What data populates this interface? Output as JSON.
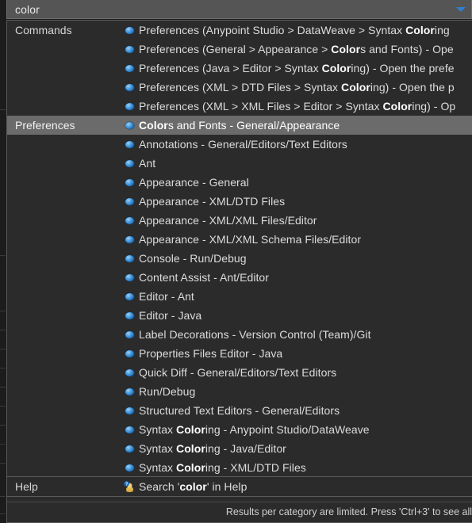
{
  "search": {
    "value": "color",
    "placeholder": "",
    "dropdown_icon": "chevron-down-icon"
  },
  "footer": {
    "text": "Results per category are limited. Press 'Ctrl+3' to see all"
  },
  "sections": [
    {
      "category": "Commands",
      "rows": [
        {
          "icon": "blue-sphere-icon",
          "prefix": "Preferences (Anypoint Studio > DataWeave > Syntax ",
          "match": "Color",
          "suffix": "ing"
        },
        {
          "icon": "blue-sphere-icon",
          "prefix": "Preferences (General > Appearance > ",
          "match": "Color",
          "suffix": "s and Fonts) - Ope"
        },
        {
          "icon": "blue-sphere-icon",
          "prefix": "Preferences (Java > Editor > Syntax ",
          "match": "Color",
          "suffix": "ing) - Open the prefe"
        },
        {
          "icon": "blue-sphere-icon",
          "prefix": "Preferences (XML > DTD Files > Syntax ",
          "match": "Color",
          "suffix": "ing) - Open the p"
        },
        {
          "icon": "blue-sphere-icon",
          "prefix": "Preferences (XML > XML Files > Editor > Syntax ",
          "match": "Color",
          "suffix": "ing) - Op"
        }
      ]
    },
    {
      "category": "Preferences",
      "rows": [
        {
          "icon": "blue-sphere-icon",
          "prefix": "",
          "match": "Color",
          "suffix": "s and Fonts - General/Appearance",
          "selected": true
        },
        {
          "icon": "blue-sphere-icon",
          "prefix": "Annotations - General/Editors/Text Editors",
          "match": "",
          "suffix": ""
        },
        {
          "icon": "blue-sphere-icon",
          "prefix": "Ant",
          "match": "",
          "suffix": ""
        },
        {
          "icon": "blue-sphere-icon",
          "prefix": "Appearance - General",
          "match": "",
          "suffix": ""
        },
        {
          "icon": "blue-sphere-icon",
          "prefix": "Appearance - XML/DTD Files",
          "match": "",
          "suffix": ""
        },
        {
          "icon": "blue-sphere-icon",
          "prefix": "Appearance - XML/XML Files/Editor",
          "match": "",
          "suffix": ""
        },
        {
          "icon": "blue-sphere-icon",
          "prefix": "Appearance - XML/XML Schema Files/Editor",
          "match": "",
          "suffix": ""
        },
        {
          "icon": "blue-sphere-icon",
          "prefix": "Console - Run/Debug",
          "match": "",
          "suffix": ""
        },
        {
          "icon": "blue-sphere-icon",
          "prefix": "Content Assist - Ant/Editor",
          "match": "",
          "suffix": ""
        },
        {
          "icon": "blue-sphere-icon",
          "prefix": "Editor - Ant",
          "match": "",
          "suffix": ""
        },
        {
          "icon": "blue-sphere-icon",
          "prefix": "Editor - Java",
          "match": "",
          "suffix": ""
        },
        {
          "icon": "blue-sphere-icon",
          "prefix": "Label Decorations - Version Control (Team)/Git",
          "match": "",
          "suffix": ""
        },
        {
          "icon": "blue-sphere-icon",
          "prefix": "Properties Files Editor - Java",
          "match": "",
          "suffix": ""
        },
        {
          "icon": "blue-sphere-icon",
          "prefix": "Quick Diff - General/Editors/Text Editors",
          "match": "",
          "suffix": ""
        },
        {
          "icon": "blue-sphere-icon",
          "prefix": "Run/Debug",
          "match": "",
          "suffix": ""
        },
        {
          "icon": "blue-sphere-icon",
          "prefix": "Structured Text Editors - General/Editors",
          "match": "",
          "suffix": ""
        },
        {
          "icon": "blue-sphere-icon",
          "prefix": "Syntax ",
          "match": "Color",
          "suffix": "ing - Anypoint Studio/DataWeave"
        },
        {
          "icon": "blue-sphere-icon",
          "prefix": "Syntax ",
          "match": "Color",
          "suffix": "ing - Java/Editor"
        },
        {
          "icon": "blue-sphere-icon",
          "prefix": "Syntax ",
          "match": "Color",
          "suffix": "ing - XML/DTD Files"
        }
      ]
    },
    {
      "category": "Help",
      "rows": [
        {
          "icon": "help-search-icon",
          "prefix": "Search '",
          "match": "color",
          "suffix": "' in Help"
        }
      ]
    }
  ]
}
